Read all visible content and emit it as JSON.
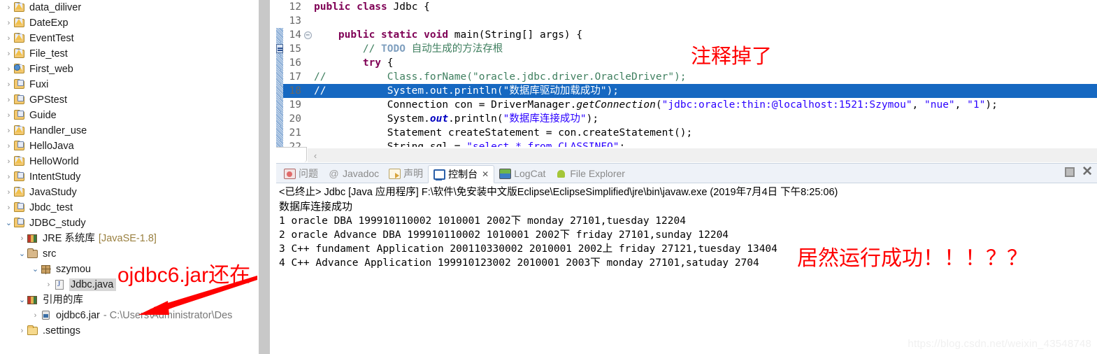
{
  "explorer": {
    "name": "package-explorer",
    "items": [
      {
        "label": "data_diliver",
        "icon": "java-project-warning-icon",
        "indent": 0,
        "expander": "collapsed"
      },
      {
        "label": "DateExp",
        "icon": "java-project-warning-icon",
        "indent": 0,
        "expander": "collapsed"
      },
      {
        "label": "EventTest",
        "icon": "java-project-warning-icon",
        "indent": 0,
        "expander": "collapsed"
      },
      {
        "label": "File_test",
        "icon": "java-project-warning-icon",
        "indent": 0,
        "expander": "collapsed"
      },
      {
        "label": "First_web",
        "icon": "web-project-warning-icon",
        "indent": 0,
        "expander": "collapsed"
      },
      {
        "label": "Fuxi",
        "icon": "java-project-icon",
        "indent": 0,
        "expander": "collapsed"
      },
      {
        "label": "GPStest",
        "icon": "java-project-icon",
        "indent": 0,
        "expander": "collapsed"
      },
      {
        "label": "Guide",
        "icon": "java-project-icon",
        "indent": 0,
        "expander": "collapsed"
      },
      {
        "label": "Handler_use",
        "icon": "java-project-warning-icon",
        "indent": 0,
        "expander": "collapsed"
      },
      {
        "label": "HelloJava",
        "icon": "java-project-icon",
        "indent": 0,
        "expander": "collapsed"
      },
      {
        "label": "HelloWorld",
        "icon": "java-project-warning-icon",
        "indent": 0,
        "expander": "collapsed"
      },
      {
        "label": "IntentStudy",
        "icon": "java-project-icon",
        "indent": 0,
        "expander": "collapsed"
      },
      {
        "label": "JavaStudy",
        "icon": "java-project-warning-icon",
        "indent": 0,
        "expander": "collapsed"
      },
      {
        "label": "Jbdc_test",
        "icon": "java-project-icon",
        "indent": 0,
        "expander": "collapsed"
      },
      {
        "label": "JDBC_study",
        "icon": "java-project-icon",
        "indent": 0,
        "expander": "expanded"
      },
      {
        "label": "JRE 系统库",
        "suffix": "[JavaSE-1.8]",
        "icon": "library-icon",
        "indent": 1,
        "expander": "collapsed"
      },
      {
        "label": "src",
        "icon": "source-folder-icon",
        "indent": 1,
        "expander": "expanded"
      },
      {
        "label": "szymou",
        "icon": "package-icon",
        "indent": 2,
        "expander": "expanded"
      },
      {
        "label": "Jdbc.java",
        "icon": "java-file-icon",
        "indent": 3,
        "expander": "collapsed",
        "selected": true
      },
      {
        "label": "引用的库",
        "icon": "library-icon",
        "indent": 1,
        "expander": "expanded"
      },
      {
        "label": "ojdbc6.jar",
        "path": "- C:\\Users\\Administrator\\Des",
        "icon": "jar-icon",
        "indent": 2,
        "expander": "collapsed"
      },
      {
        "label": ".settings",
        "icon": "plain-folder-icon",
        "indent": 1,
        "expander": "collapsed"
      }
    ]
  },
  "editor": {
    "name": "java-source-editor",
    "hscroll_left_label": "‹",
    "lines": [
      {
        "num": "12",
        "marker": "none",
        "fold": "",
        "tokens": [
          {
            "t": "public ",
            "c": "kw"
          },
          {
            "t": "class ",
            "c": "kw"
          },
          {
            "t": "Jdbc {",
            "c": "plain"
          }
        ]
      },
      {
        "num": "13",
        "marker": "none",
        "fold": "",
        "tokens": []
      },
      {
        "num": "14",
        "marker": "annot",
        "fold": "minus",
        "tokens": [
          {
            "t": "    ",
            "c": "plain"
          },
          {
            "t": "public ",
            "c": "kw"
          },
          {
            "t": "static ",
            "c": "kw"
          },
          {
            "t": "void ",
            "c": "kw"
          },
          {
            "t": "main(String[] args) {",
            "c": "plain"
          }
        ]
      },
      {
        "num": "15",
        "marker": "task",
        "fold": "",
        "tokens": [
          {
            "t": "        ",
            "c": "plain"
          },
          {
            "t": "// ",
            "c": "cmt"
          },
          {
            "t": "TODO",
            "c": "todo"
          },
          {
            "t": " 自动生成的方法存根",
            "c": "cmt"
          }
        ]
      },
      {
        "num": "16",
        "marker": "annot",
        "fold": "",
        "tokens": [
          {
            "t": "        ",
            "c": "plain"
          },
          {
            "t": "try",
            "c": "kw"
          },
          {
            "t": " {",
            "c": "plain"
          }
        ]
      },
      {
        "num": "17",
        "marker": "annot",
        "fold": "",
        "tokens": [
          {
            "t": "//          Class.forName(",
            "c": "cmt"
          },
          {
            "t": "\"oracle.jdbc.driver.OracleDriver\"",
            "c": "cmt"
          },
          {
            "t": ");",
            "c": "cmt"
          }
        ]
      },
      {
        "num": "18",
        "marker": "annot",
        "fold": "",
        "highlight": true,
        "tokens": [
          {
            "t": "//          System.out.println(\"数据库驱动加载成功\");",
            "c": "cmt"
          }
        ]
      },
      {
        "num": "19",
        "marker": "annot",
        "fold": "",
        "tokens": [
          {
            "t": "            Connection con = DriverManager.",
            "c": "plain"
          },
          {
            "t": "getConnection",
            "c": "call"
          },
          {
            "t": "(",
            "c": "plain"
          },
          {
            "t": "\"jdbc:oracle:thin:@localhost:1521:Szymou\"",
            "c": "str"
          },
          {
            "t": ", ",
            "c": "plain"
          },
          {
            "t": "\"nue\"",
            "c": "str"
          },
          {
            "t": ", ",
            "c": "plain"
          },
          {
            "t": "\"1\"",
            "c": "str"
          },
          {
            "t": ");",
            "c": "plain"
          }
        ]
      },
      {
        "num": "20",
        "marker": "annot",
        "fold": "",
        "tokens": [
          {
            "t": "            System.",
            "c": "plain"
          },
          {
            "t": "out",
            "c": "stat"
          },
          {
            "t": ".println(",
            "c": "plain"
          },
          {
            "t": "\"数据库连接成功\"",
            "c": "str"
          },
          {
            "t": ");",
            "c": "plain"
          }
        ]
      },
      {
        "num": "21",
        "marker": "annot",
        "fold": "",
        "tokens": [
          {
            "t": "            Statement createStatement = con.createStatement();",
            "c": "plain"
          }
        ]
      },
      {
        "num": "22",
        "marker": "annot",
        "fold": "",
        "tokens": [
          {
            "t": "            String sql = ",
            "c": "plain"
          },
          {
            "t": "\"select * from CLASSINFO\"",
            "c": "str"
          },
          {
            "t": ";",
            "c": "plain"
          }
        ]
      }
    ]
  },
  "console": {
    "name": "console-view",
    "tabs": [
      {
        "label": "问题",
        "icon": "problems-icon",
        "active": false
      },
      {
        "label": "Javadoc",
        "icon": "javadoc-icon",
        "active": false
      },
      {
        "label": "声明",
        "icon": "declaration-icon",
        "active": false
      },
      {
        "label": "控制台",
        "icon": "console-icon",
        "active": true,
        "close": "✕"
      },
      {
        "label": "LogCat",
        "icon": "logcat-icon",
        "active": false
      },
      {
        "label": "File Explorer",
        "icon": "android-icon",
        "active": false
      }
    ],
    "controls": {
      "maximize": "maximize-icon",
      "close": "✕"
    },
    "header": "<已终止> Jdbc [Java 应用程序] F:\\软件\\免安装中文版Eclipse\\EclipseSimplified\\jre\\bin\\javaw.exe  (2019年7月4日 下午8:25:06)",
    "status_line": "数据库连接成功",
    "rows": [
      "1 oracle DBA 199910110002 1010001 2002下 monday 27101,tuesday 12204",
      "2 oracle Advance DBA 199910110002 1010001 2002下 friday 27101,sunday 12204",
      "3 C++ fundament Application 200110330002 2010001 2002上 friday 27121,tuesday 13404",
      "4 C++ Advance Application 199910123002 2010001 2003下 monday 27101,satuday 2704"
    ]
  },
  "annotations": {
    "comment_note": "注释掉了",
    "jar_note": "ojdbc6.jar还在",
    "success_note": "居然运行成功！！！？？",
    "arrow": "red-arrow",
    "color": "#ff0000"
  },
  "watermark": "https://blog.csdn.net/weixin_43548748"
}
